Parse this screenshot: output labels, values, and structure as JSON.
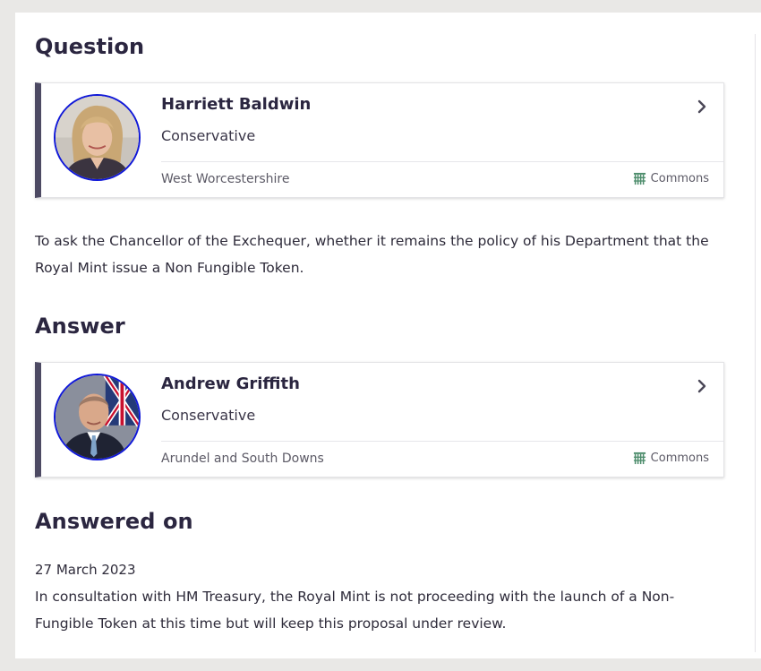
{
  "question": {
    "heading": "Question",
    "member": {
      "name": "Harriett Baldwin",
      "party": "Conservative",
      "constituency": "West Worcestershire",
      "house": "Commons",
      "house_icon": "portcullis-icon",
      "avatar_border_color": "#1018d8"
    },
    "text": "To ask the Chancellor of the Exchequer, whether it remains the policy of his Department that the Royal Mint issue a Non Fungible Token."
  },
  "answer": {
    "heading": "Answer",
    "member": {
      "name": "Andrew Griffith",
      "party": "Conservative",
      "constituency": "Arundel and South Downs",
      "house": "Commons",
      "house_icon": "portcullis-icon",
      "avatar_border_color": "#1018d8"
    }
  },
  "answered_on": {
    "heading": "Answered on",
    "date": "27 March 2023",
    "text": "In consultation with HM Treasury, the Royal Mint is not proceeding with the launch of a Non-Fungible Token at this time but will keep this proposal under review."
  },
  "colors": {
    "card_accent": "#4d4a63",
    "commons_green": "#006e46",
    "heading": "#2b2640"
  }
}
